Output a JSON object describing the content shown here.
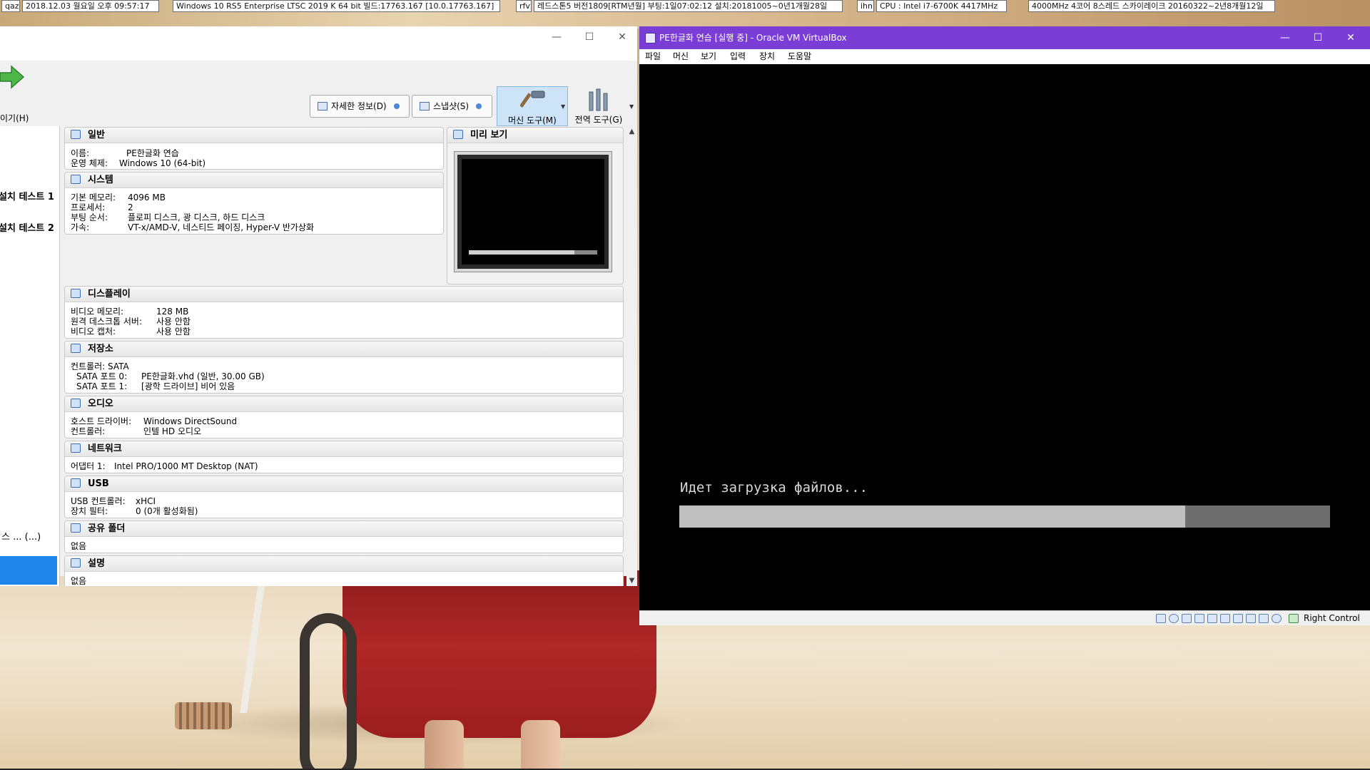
{
  "infobar": {
    "items": [
      "qaz",
      "2018.12.03 월요일 오후 09:57:17",
      "Windows 10 RS5 Enterprise LTSC 2019 K 64 bit 빌드:17763.167 [10.0.17763.167]",
      "rfv",
      "레드스톤5 버전1809[RTM년월] 부팅:1일07:02:12 설치:20181005~0년1개월28일",
      "ihn",
      "CPU : Intel i7-6700K 4417MHz",
      "4000MHz 4코어 8스레드 스카이레이크 20160322~2년8개월12일"
    ]
  },
  "manager": {
    "window_buttons": {
      "minimize": "—",
      "maximize": "☐",
      "close": "✕"
    },
    "toolbar": {
      "start_label": "이기(H)",
      "details_label": "자세한 정보(D)",
      "snapshots_label": "스냅샷(S)",
      "machine_tools_label": "머신 도구(M)",
      "global_tools_label": "전역 도구(G)"
    },
    "vm_list": [
      "설치 테스트 1",
      "설치 테스트 2",
      "스 ... (...)"
    ],
    "sections": {
      "general": {
        "title": "일반",
        "rows": [
          {
            "k": "이름:",
            "v": "PE한글화 연습"
          },
          {
            "k": "운영 체제:",
            "v": "Windows 10 (64-bit)"
          }
        ]
      },
      "system": {
        "title": "시스템",
        "rows": [
          {
            "k": "기본 메모리:",
            "v": "4096 MB"
          },
          {
            "k": "프로세서:",
            "v": "2"
          },
          {
            "k": "부팅 순서:",
            "v": "플로피 디스크, 광 디스크, 하드 디스크"
          },
          {
            "k": "가속:",
            "v": "VT-x/AMD-V, 네스티드 페이징, Hyper-V 반가상화"
          }
        ]
      },
      "preview": {
        "title": "미리 보기",
        "progress": 0.82
      },
      "display": {
        "title": "디스플레이",
        "rows": [
          {
            "k": "비디오 메모리:",
            "v": "128 MB"
          },
          {
            "k": "원격 데스크톱 서버:",
            "v": "사용 안함"
          },
          {
            "k": "비디오 캡처:",
            "v": "사용 안함"
          }
        ]
      },
      "storage": {
        "title": "저장소",
        "rows": [
          {
            "k": "컨트롤러: SATA",
            "v": ""
          },
          {
            "k": "  SATA 포트 0:",
            "v": "PE한글화.vhd (일반, 30.00 GB)"
          },
          {
            "k": "  SATA 포트 1:",
            "v": "[광학 드라이브] 비어 있음"
          }
        ]
      },
      "audio": {
        "title": "오디오",
        "rows": [
          {
            "k": "호스트 드라이버:",
            "v": "Windows DirectSound"
          },
          {
            "k": "컨트롤러:",
            "v": "인텔 HD 오디오"
          }
        ]
      },
      "network": {
        "title": "네트워크",
        "rows": [
          {
            "k": "어댑터 1:",
            "v": "Intel PRO/1000 MT Desktop (NAT)"
          }
        ]
      },
      "usb": {
        "title": "USB",
        "rows": [
          {
            "k": "USB 컨트롤러:",
            "v": "xHCI"
          },
          {
            "k": "장치 필터:",
            "v": "0 (0개 활성화됨)"
          }
        ]
      },
      "shared": {
        "title": "공유 폴더",
        "rows": [
          {
            "k": "없음",
            "v": ""
          }
        ]
      },
      "description": {
        "title": "설명",
        "rows": [
          {
            "k": "없음",
            "v": ""
          }
        ]
      }
    }
  },
  "vm_window": {
    "title": "PE한글화 연습 [실행 중] - Oracle VM VirtualBox",
    "window_buttons": {
      "minimize": "—",
      "maximize": "☐",
      "close": "✕"
    },
    "menu": [
      "파일",
      "머신",
      "보기",
      "입력",
      "장치",
      "도움말"
    ],
    "console_text": "Идет загрузка файлов...",
    "progress": 0.777,
    "host_key": "Right Control",
    "status_icons": [
      "hard-disk-icon",
      "optical-drive-icon",
      "audio-icon",
      "network-icon",
      "usb-icon",
      "shared-folder-icon",
      "display-icon",
      "video-capture-icon",
      "cpu-icon",
      "mouse-integration-icon",
      "host-key-icon"
    ]
  },
  "colors": {
    "vm_titlebar": "#7a3ed6",
    "selection": "#1e86ea",
    "active_tool": "#cde3f7"
  }
}
